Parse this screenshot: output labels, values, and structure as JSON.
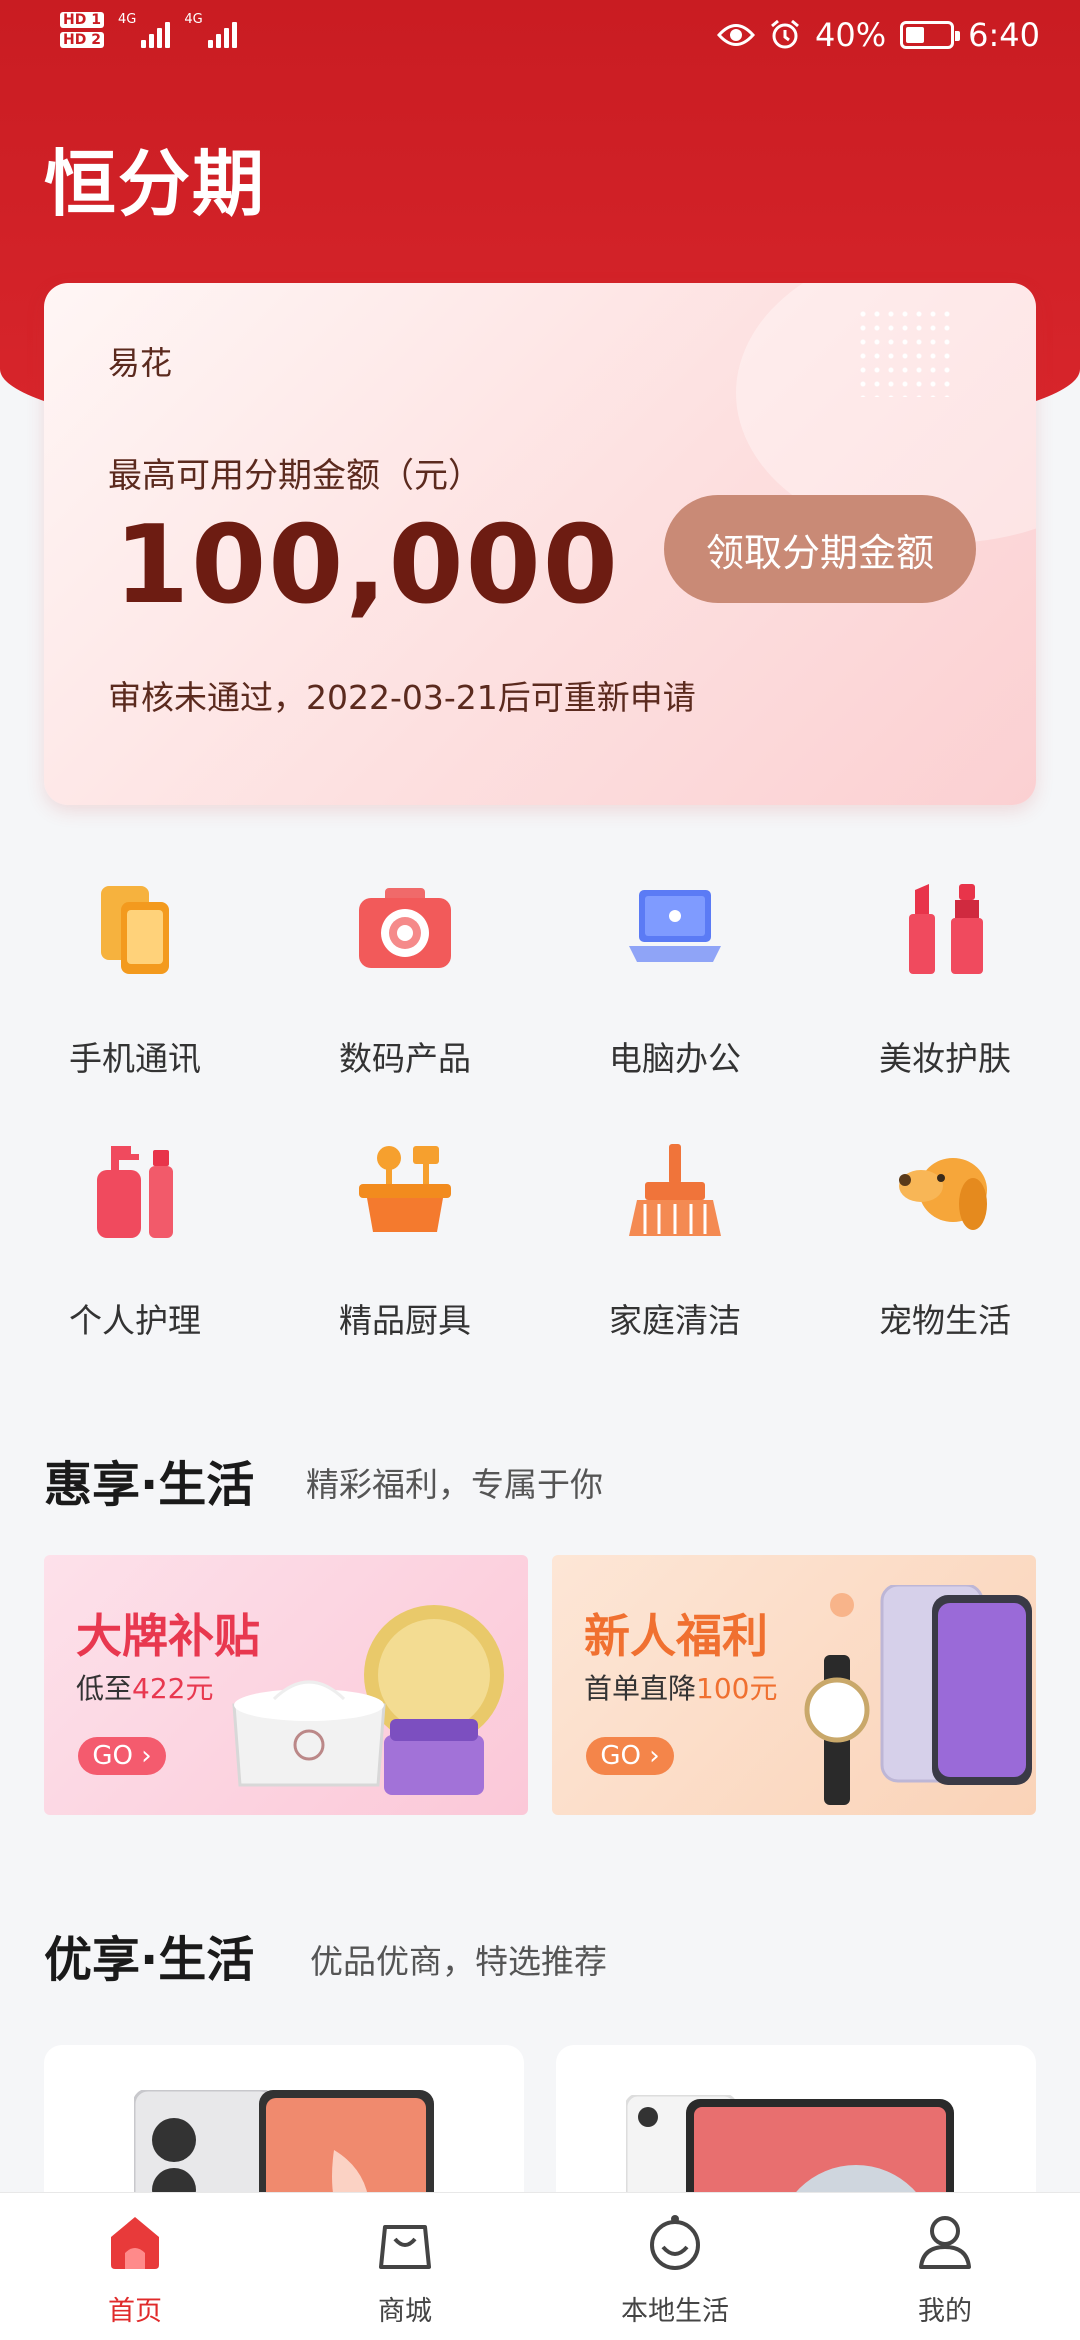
{
  "status_bar": {
    "hd1": "HD 1",
    "hd2": "HD 2",
    "net1": "4G",
    "net2": "4G",
    "battery": "40%",
    "time": "6:40"
  },
  "app": {
    "title": "恒分期"
  },
  "card": {
    "label": "易花",
    "subtitle": "最高可用分期金额（元）",
    "amount": "100,000",
    "button": "领取分期金额",
    "note": "审核未通过，2022-03-21后可重新申请"
  },
  "categories": [
    {
      "label": "手机通讯",
      "icon": "phone-icon"
    },
    {
      "label": "数码产品",
      "icon": "camera-icon"
    },
    {
      "label": "电脑办公",
      "icon": "laptop-icon"
    },
    {
      "label": "美妆护肤",
      "icon": "lipstick-icon"
    },
    {
      "label": "个人护理",
      "icon": "lotion-bottle-icon"
    },
    {
      "label": "精品厨具",
      "icon": "cookware-icon"
    },
    {
      "label": "家庭清洁",
      "icon": "broom-icon"
    },
    {
      "label": "宠物生活",
      "icon": "dog-icon"
    }
  ],
  "section1": {
    "title": "惠享·生活",
    "subtitle": "精彩福利，专属于你"
  },
  "promos": [
    {
      "title": "大牌补贴",
      "desc_prefix": "低至",
      "desc_value": "422元",
      "go": "GO"
    },
    {
      "title": "新人福利",
      "desc_prefix": "首单直降",
      "desc_value": "100元",
      "go": "GO"
    }
  ],
  "section2": {
    "title": "优享·生活",
    "subtitle": "优品优商，特选推荐"
  },
  "tabs": [
    {
      "label": "首页",
      "icon": "home-icon",
      "active": true
    },
    {
      "label": "商城",
      "icon": "shopping-bag-icon",
      "active": false
    },
    {
      "label": "本地生活",
      "icon": "smiley-icon",
      "active": false
    },
    {
      "label": "我的",
      "icon": "profile-icon",
      "active": false
    }
  ],
  "colors": {
    "brand_red": "#d9262c",
    "card_button": "#c98a76",
    "amount_text": "#6d1c12",
    "tab_active": "#e02b2b"
  }
}
